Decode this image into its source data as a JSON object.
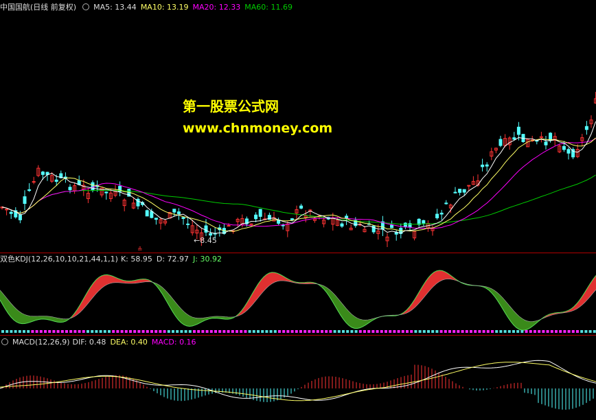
{
  "main_panel": {
    "title": "中国国航(日线 前复权)",
    "indicators": [
      {
        "label": "MA5: 13.44",
        "color": "#dddddd"
      },
      {
        "label": "MA10: 13.19",
        "color": "#ffff66"
      },
      {
        "label": "MA20: 12.33",
        "color": "#ff00ff"
      },
      {
        "label": "MA60: 11.69",
        "color": "#00cc00"
      }
    ],
    "low_marker": "8.45"
  },
  "watermark": {
    "line1": "第一股票公式网",
    "line2": "www.chnmoney.com"
  },
  "kdj_panel": {
    "title": "双色KDJ(12,26,10,10,21,44,1,1)",
    "values": [
      {
        "label": "K: 58.95",
        "color": "#dddddd"
      },
      {
        "label": "D: 72.97",
        "color": "#dddddd"
      },
      {
        "label": "J: 30.92",
        "color": "#66ff66"
      }
    ]
  },
  "macd_panel": {
    "title": "MACD(12,26,9)",
    "values": [
      {
        "label": "DIF: 0.48",
        "color": "#dddddd"
      },
      {
        "label": "DEA: 0.40",
        "color": "#ffff66"
      },
      {
        "label": "MACD: 0.16",
        "color": "#ff00ff"
      }
    ]
  },
  "colors": {
    "up": "#ff3333",
    "down": "#54ffff",
    "ma5": "#ffffff",
    "ma10": "#ffff66",
    "ma20": "#ff00ff",
    "ma60": "#00cc00",
    "separator": "#b00000"
  }
}
